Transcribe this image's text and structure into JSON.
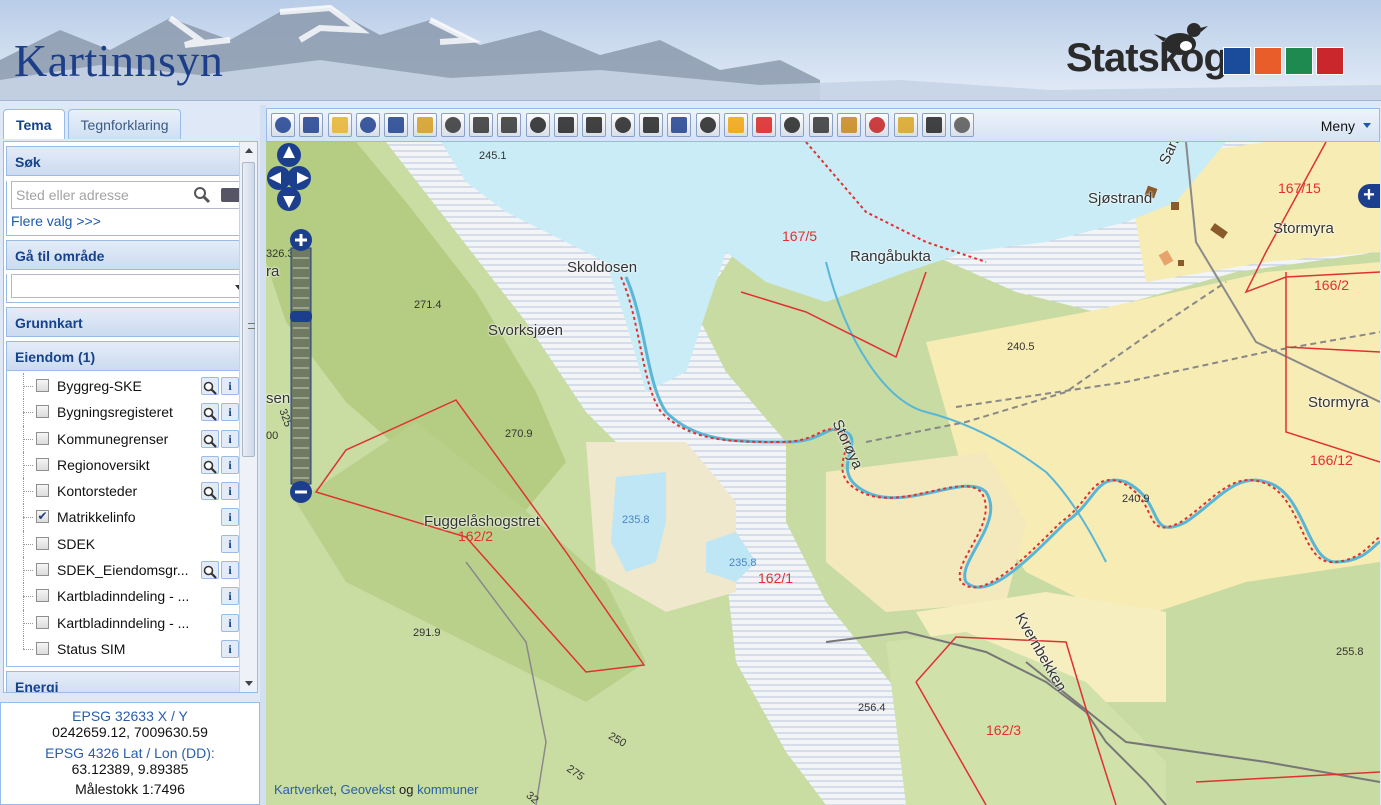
{
  "header": {
    "app_title": "Kartinnsyn",
    "brand": "Statskog",
    "brand_colors": [
      "#1b4c9c",
      "#e85d2a",
      "#1e8a50",
      "#c9272c"
    ]
  },
  "left_panel": {
    "tabs": [
      {
        "label": "Tema",
        "active": true
      },
      {
        "label": "Tegnforklaring",
        "active": false
      }
    ],
    "search": {
      "title": "Søk",
      "placeholder": "Sted eller adresse",
      "more_link": "Flere valg >>>"
    },
    "goto_area": {
      "title": "Gå til område",
      "selected": ""
    },
    "basemap": {
      "title": "Grunnkart"
    },
    "property": {
      "title": "Eiendom (1)",
      "layers": [
        {
          "label": "Byggreg-SKE",
          "checked": false,
          "zoom": true,
          "info": true
        },
        {
          "label": "Bygningsregisteret",
          "checked": false,
          "zoom": true,
          "info": true
        },
        {
          "label": "Kommunegrenser",
          "checked": false,
          "zoom": true,
          "info": true
        },
        {
          "label": "Regionoversikt",
          "checked": false,
          "zoom": true,
          "info": true
        },
        {
          "label": "Kontorsteder",
          "checked": false,
          "zoom": true,
          "info": true
        },
        {
          "label": "Matrikkelinfo",
          "checked": true,
          "zoom": false,
          "info": true
        },
        {
          "label": "SDEK",
          "checked": false,
          "zoom": false,
          "info": true
        },
        {
          "label": "SDEK_Eiendomsgr...",
          "checked": false,
          "zoom": true,
          "info": true
        },
        {
          "label": "Kartbladinndeling - ...",
          "checked": false,
          "zoom": false,
          "info": true
        },
        {
          "label": "Kartbladinndeling - ...",
          "checked": false,
          "zoom": false,
          "info": true
        },
        {
          "label": "Status SIM",
          "checked": false,
          "zoom": false,
          "info": true
        }
      ]
    },
    "energy": {
      "title": "Energi"
    },
    "info_icon_text": "i"
  },
  "coordinates": {
    "utm_label": "EPSG 32633 X / Y",
    "utm_value": "0242659.12, 7009630.59",
    "latlon_label": "EPSG 4326 Lat / Lon (DD):",
    "latlon_value": "63.12389, 9.89385",
    "scale": "Målestokk 1:7496"
  },
  "toolbar": {
    "tools": [
      "binoculars-icon",
      "binoculars-select-icon",
      "pan-hand-icon",
      "zoom-in-icon",
      "zoom-out-icon",
      "zoom-extent-icon",
      "refresh-icon",
      "print-icon",
      "help-icon",
      "point-icon",
      "text-icon",
      "line-icon",
      "polygon-icon",
      "rectangle-icon",
      "edit-icon",
      "document-icon",
      "sun-icon",
      "red-cross-icon",
      "utm-icon",
      "measure-icon",
      "terrain-icon",
      "delete-icon",
      "undo-icon",
      "profile-icon",
      "satellite-icon"
    ],
    "menu_label": "Meny"
  },
  "map": {
    "place_names": [
      {
        "text": "Skoldosen"
      },
      {
        "text": "Svorksjøen"
      },
      {
        "text": "Rangåbukta"
      },
      {
        "text": "Sjøstrand"
      },
      {
        "text": "Stormyra"
      },
      {
        "text": "Stormyra"
      },
      {
        "text": "Fuggelåshogstret"
      },
      {
        "text": "Kvernbekken"
      },
      {
        "text": "Storøya"
      },
      {
        "text": "Sandla"
      },
      {
        "text": "ra"
      },
      {
        "text": "sen"
      }
    ],
    "elevations": [
      "245.1",
      "326.3",
      "271.4",
      "270.9",
      "240.5",
      "240.9",
      "291.9",
      "256.4",
      "255.8",
      "250",
      "275",
      "32",
      "325",
      "00"
    ],
    "lake_elevations": [
      "235.8",
      "235.8"
    ],
    "parcels": [
      "167/5",
      "167/15",
      "166/2",
      "166/12",
      "162/2",
      "162/1",
      "162/3"
    ],
    "attribution": {
      "link1": "Kartverket",
      "sep1": ", ",
      "link2": "Geovekst",
      "sep2": " og ",
      "link3": "kommuner"
    },
    "zoom_level_fraction": 0.28
  }
}
